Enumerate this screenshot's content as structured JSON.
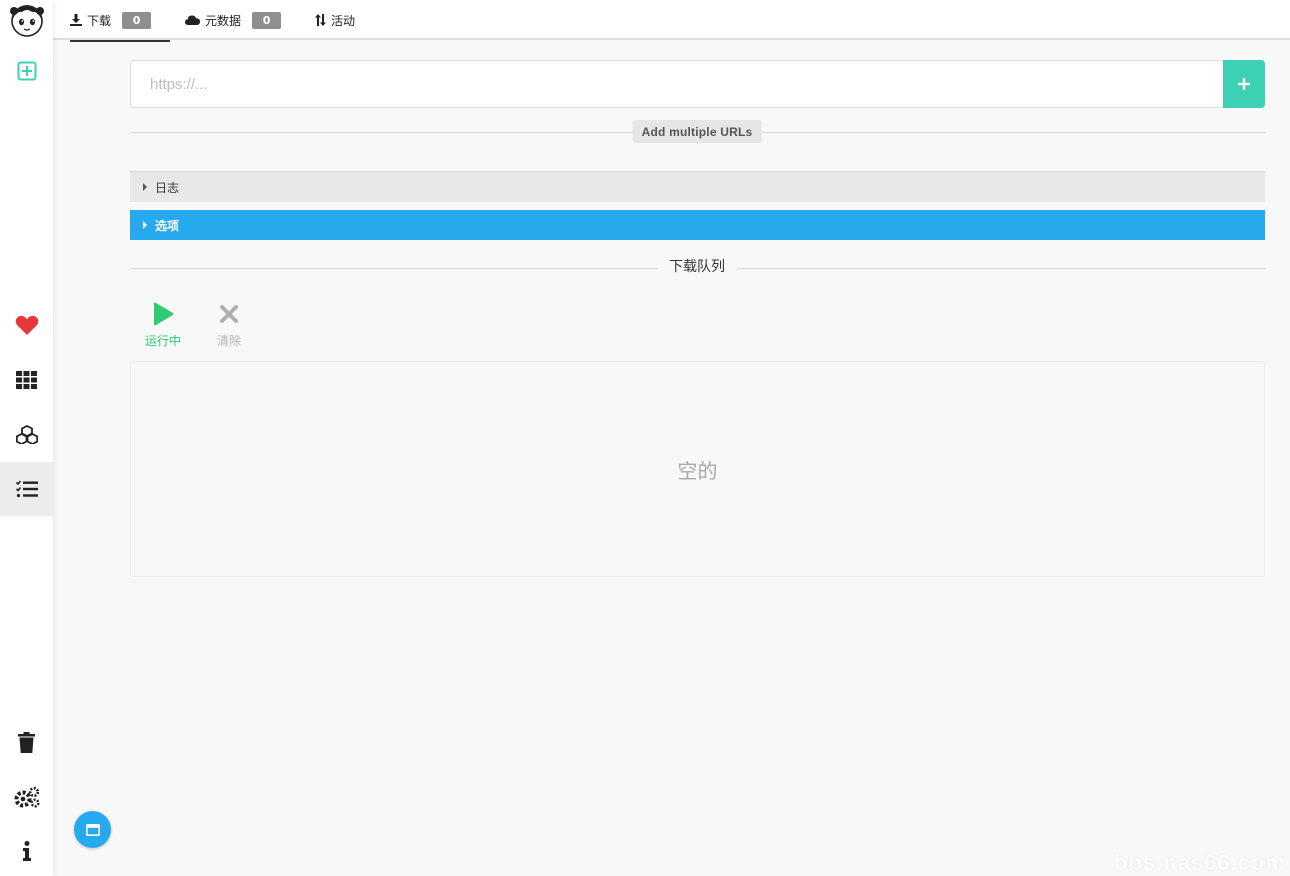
{
  "colors": {
    "accent_teal": "#3dd1b3",
    "accent_blue": "#27a9ee",
    "running_green": "#2ecc71",
    "heart_red": "#e8373c",
    "badge_gray": "#8f8f8f"
  },
  "sidebar": {
    "items": [
      {
        "name": "avatar-logo",
        "icon": "anime-girl-avatar"
      },
      {
        "name": "add-download",
        "icon": "plus-square-icon"
      },
      {
        "name": "favorites",
        "icon": "heart-icon"
      },
      {
        "name": "apps-grid",
        "icon": "grid-icon"
      },
      {
        "name": "packages",
        "icon": "cubes-icon"
      },
      {
        "name": "task-list",
        "icon": "list-check-icon",
        "active": true
      },
      {
        "name": "trash",
        "icon": "trash-icon"
      },
      {
        "name": "settings",
        "icon": "gears-icon"
      },
      {
        "name": "info",
        "icon": "info-icon"
      }
    ]
  },
  "tabs": [
    {
      "label": "下载",
      "icon": "download-icon",
      "count": "0",
      "active": true
    },
    {
      "label": "元数据",
      "icon": "cloud-icon",
      "count": "0"
    },
    {
      "label": "活动",
      "icon": "sort-arrows-icon"
    }
  ],
  "url_input": {
    "placeholder": "https://...",
    "value": ""
  },
  "multi_urls_label": "Add multiple URLs",
  "panels": {
    "log_label": "日志",
    "options_label": "选项"
  },
  "queue": {
    "title": "下载队列",
    "running_label": "运行中",
    "clear_label": "清除",
    "empty_text": "空的"
  },
  "watermark": "bbs.nas66.com"
}
